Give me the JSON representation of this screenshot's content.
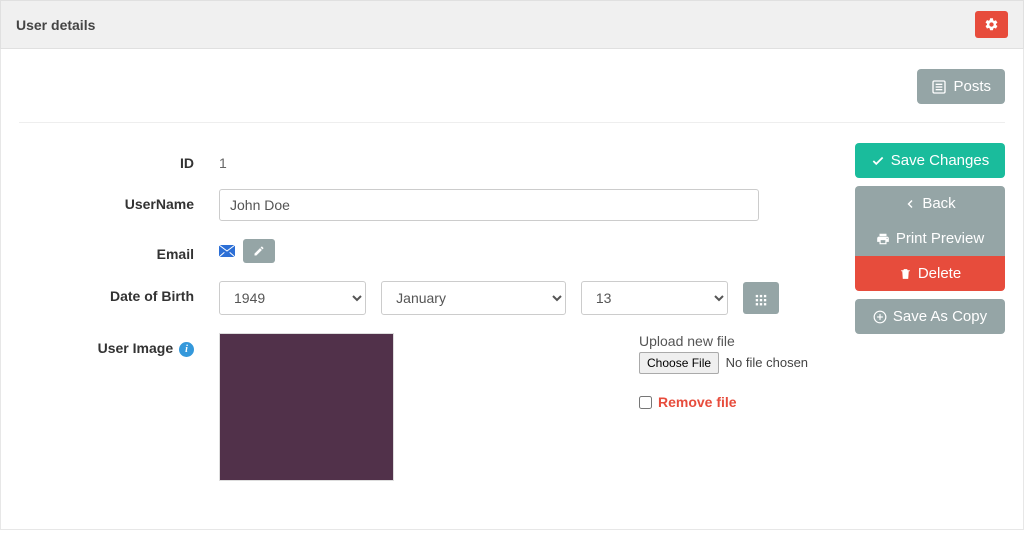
{
  "header": {
    "title": "User details"
  },
  "toolbar": {
    "posts": "Posts"
  },
  "form": {
    "id_label": "ID",
    "id_value": "1",
    "username_label": "UserName",
    "username_value": "John Doe",
    "email_label": "Email",
    "dob_label": "Date of Birth",
    "dob_year": "1949",
    "dob_month": "January",
    "dob_day": "13",
    "image_label": "User Image",
    "upload_label": "Upload new file",
    "choose_file": "Choose File",
    "no_file": "No file chosen",
    "remove_file": "Remove file"
  },
  "actions": {
    "save": "Save Changes",
    "back": "Back",
    "print": "Print Preview",
    "delete": "Delete",
    "save_copy": "Save As Copy"
  },
  "colors": {
    "image_preview": "#51314a"
  }
}
